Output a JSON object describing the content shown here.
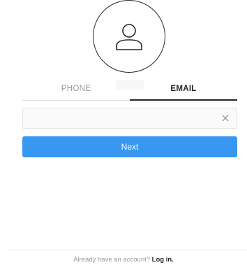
{
  "avatar": {
    "icon": "user-outline-icon"
  },
  "tabs": {
    "phone_label": "PHONE",
    "email_label": "EMAIL",
    "active": "email"
  },
  "email_input": {
    "value": "",
    "placeholder": "",
    "clear_icon": "close-icon"
  },
  "next_button": {
    "label": "Next",
    "color": "#3897f0"
  },
  "footer": {
    "prompt": "Already have an account?",
    "login_label": "Log in."
  },
  "colors": {
    "text_primary": "#262626",
    "text_secondary": "#999999",
    "accent": "#3897f0",
    "border": "#dbdbdb"
  }
}
